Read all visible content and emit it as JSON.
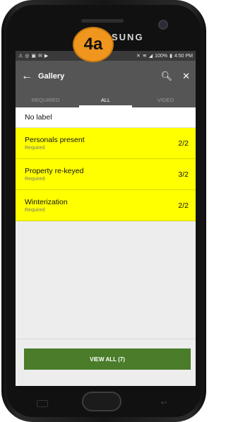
{
  "device": {
    "brand": "SUNG",
    "badge": "4a"
  },
  "status_bar": {
    "battery": "100%",
    "time": "4:50 PM"
  },
  "toolbar": {
    "back_icon": "arrow-left-icon",
    "title": "Gallery",
    "search_icon": "search-icon",
    "close_icon": "close-icon"
  },
  "tabs": [
    {
      "label": "REQUIRED",
      "active": false
    },
    {
      "label": "ALL",
      "active": true
    },
    {
      "label": "VIDEO",
      "active": false
    }
  ],
  "no_label": "No label",
  "items": [
    {
      "name": "Personals present",
      "sub": "Required",
      "count": "2/2"
    },
    {
      "name": "Property re-keyed",
      "sub": "Required",
      "count": "3/2"
    },
    {
      "name": "Winterization",
      "sub": "Required",
      "count": "2/2"
    }
  ],
  "footer": {
    "view_all": "VIEW ALL (7)"
  },
  "colors": {
    "highlight": "#ffff00",
    "button": "#4a7c2a",
    "badge": "#f0961e"
  }
}
